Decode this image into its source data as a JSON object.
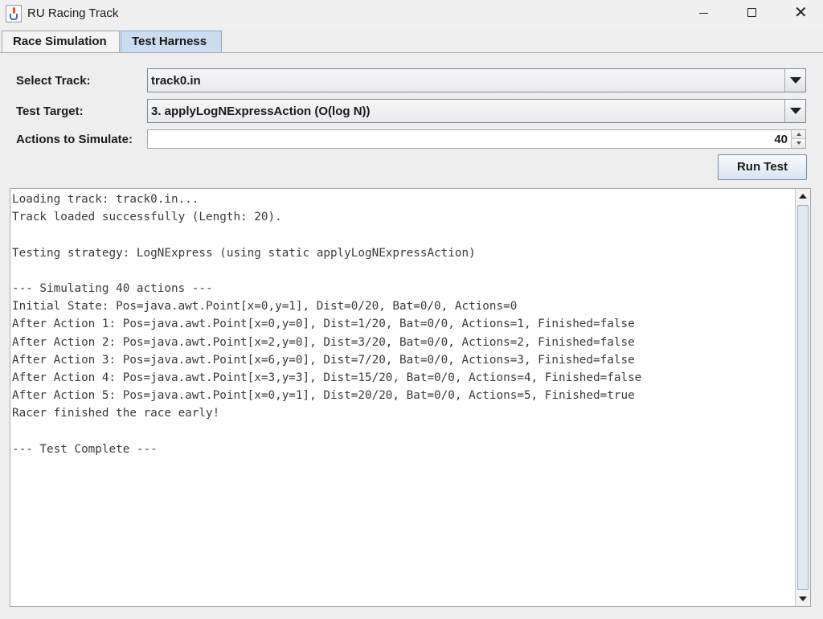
{
  "window": {
    "title": "RU Racing Track",
    "app_icon": "java-cup-icon",
    "controls": {
      "minimize": "minimize-icon",
      "maximize": "maximize-icon",
      "close": "close-icon"
    }
  },
  "tabs": [
    {
      "label": "Race Simulation",
      "selected": false
    },
    {
      "label": "Test Harness",
      "selected": true
    }
  ],
  "form": {
    "select_track_label": "Select Track:",
    "select_track_value": "track0.in",
    "test_target_label": "Test Target:",
    "test_target_value": "3. applyLogNExpressAction (O(log N))",
    "actions_label": "Actions to Simulate:",
    "actions_value": "40",
    "run_button": "Run Test"
  },
  "output": {
    "lines": [
      "Loading track: track0.in...",
      "Track loaded successfully (Length: 20).",
      "",
      "Testing strategy: LogNExpress (using static applyLogNExpressAction)",
      "",
      "--- Simulating 40 actions ---",
      "Initial State: Pos=java.awt.Point[x=0,y=1], Dist=0/20, Bat=0/0, Actions=0",
      "After Action 1: Pos=java.awt.Point[x=0,y=0], Dist=1/20, Bat=0/0, Actions=1, Finished=false",
      "After Action 2: Pos=java.awt.Point[x=2,y=0], Dist=3/20, Bat=0/0, Actions=2, Finished=false",
      "After Action 3: Pos=java.awt.Point[x=6,y=0], Dist=7/20, Bat=0/0, Actions=3, Finished=false",
      "After Action 4: Pos=java.awt.Point[x=3,y=3], Dist=15/20, Bat=0/0, Actions=4, Finished=false",
      "After Action 5: Pos=java.awt.Point[x=0,y=1], Dist=20/20, Bat=0/0, Actions=5, Finished=true",
      "Racer finished the race early!",
      "",
      "--- Test Complete ---"
    ]
  },
  "colors": {
    "selected_tab": "#c9dcf0",
    "button_gradient_end": "#d9e4f1",
    "output_text": "#3a3a3a"
  }
}
